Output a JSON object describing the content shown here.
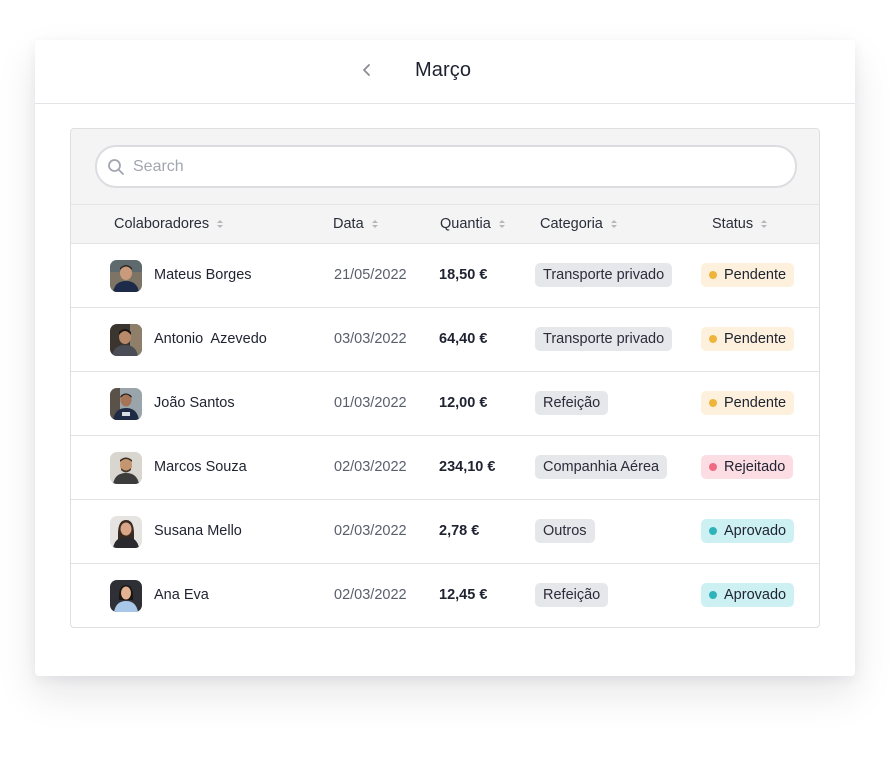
{
  "header": {
    "title": "Março",
    "back_icon": "chevron-left-icon"
  },
  "search": {
    "placeholder": "Search",
    "value": "",
    "icon": "search-icon"
  },
  "table": {
    "columns": [
      {
        "label": "Colaboradores",
        "sort_icon": "sort-icon"
      },
      {
        "label": "Data",
        "sort_icon": "sort-icon"
      },
      {
        "label": "Quantia",
        "sort_icon": "sort-icon"
      },
      {
        "label": "Categoria",
        "sort_icon": "sort-icon"
      },
      {
        "label": "Status",
        "sort_icon": "sort-icon"
      }
    ],
    "rows": [
      {
        "name": "Mateus Borges",
        "date": "21/05/2022",
        "amount": "18,50 €",
        "category": "Transporte privado",
        "status": "Pendente"
      },
      {
        "name": "Antonio  Azevedo",
        "date": "03/03/2022",
        "amount": "64,40 €",
        "category": "Transporte privado",
        "status": "Pendente"
      },
      {
        "name": "João Santos",
        "date": "01/03/2022",
        "amount": "12,00 €",
        "category": "Refeição",
        "status": "Pendente"
      },
      {
        "name": "Marcos Souza",
        "date": "02/03/2022",
        "amount": "234,10 €",
        "category": "Companhia Aérea",
        "status": "Rejeitado"
      },
      {
        "name": "Susana Mello",
        "date": "02/03/2022",
        "amount": "2,78 €",
        "category": "Outros",
        "status": "Aprovado"
      },
      {
        "name": "Ana Eva",
        "date": "02/03/2022",
        "amount": "12,45 €",
        "category": "Refeição",
        "status": "Aprovado"
      }
    ]
  },
  "colors": {
    "pendente": "#f0b43c",
    "rejeitado": "#ef6a82",
    "aprovado": "#2fb3b8"
  }
}
